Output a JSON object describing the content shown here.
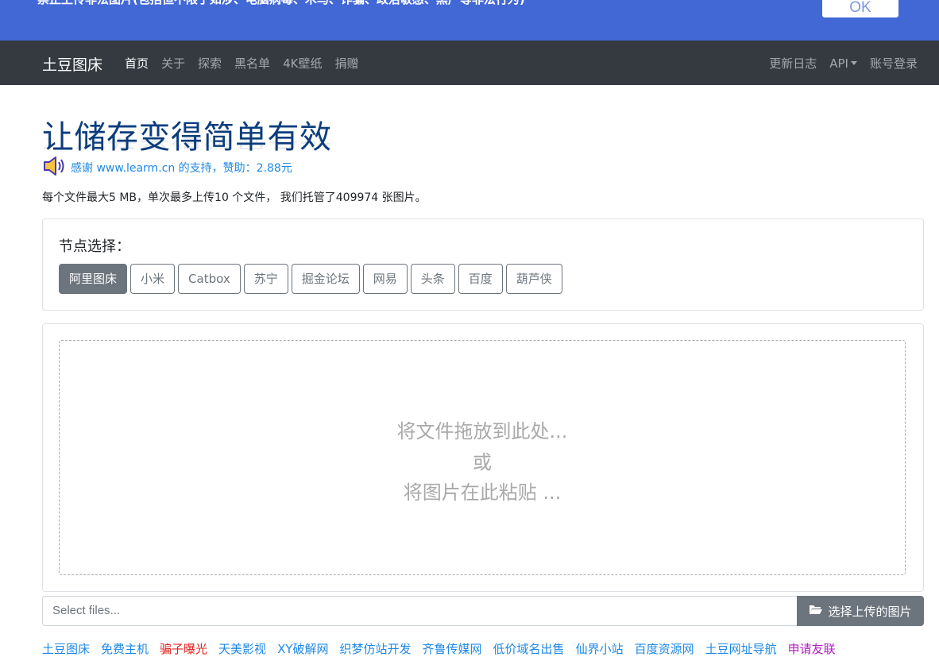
{
  "notice": {
    "text": "禁止上传非法图片(包括但不限于如涉、电脑病毒、木马、诈骗、政治敏感、黑产等非法行为)",
    "ok_label": "OK"
  },
  "navbar": {
    "brand": "土豆图床",
    "left_items": [
      "首页",
      "关于",
      "探索",
      "黑名单",
      "4K壁纸",
      "捐赠"
    ],
    "right_items": [
      "更新日志",
      "API",
      "账号登录"
    ]
  },
  "hero": {
    "title": "让储存变得简单有效",
    "sponsor": "感谢 www.learm.cn 的支持，赞助：2.88元",
    "info": "每个文件最大5 MB，单次最多上传10 个文件， 我们托管了409974 张图片。"
  },
  "nodes": {
    "label": "节点选择：",
    "options": [
      "阿里图床",
      "小米",
      "Catbox",
      "苏宁",
      "掘金论坛",
      "网易",
      "头条",
      "百度",
      "葫芦侠"
    ],
    "selected": "阿里图床"
  },
  "dropzone": {
    "line1": "将文件拖放到此处...",
    "line2": "或",
    "line3": "将图片在此粘贴 ..."
  },
  "file_select": {
    "placeholder": "Select files...",
    "button_label": "选择上传的图片"
  },
  "footer_links": [
    {
      "label": "土豆图床",
      "color": "#1e88e5"
    },
    {
      "label": "免费主机",
      "color": "#1e88e5"
    },
    {
      "label": "骗子曝光",
      "color": "#e02020"
    },
    {
      "label": "天美影视",
      "color": "#1e88e5"
    },
    {
      "label": "XY破解网",
      "color": "#1e88e5"
    },
    {
      "label": "织梦仿站开发",
      "color": "#1e88e5"
    },
    {
      "label": "齐鲁传媒网",
      "color": "#1e88e5"
    },
    {
      "label": "低价域名出售",
      "color": "#1e88e5"
    },
    {
      "label": "仙界小站",
      "color": "#1e88e5"
    },
    {
      "label": "百度资源网",
      "color": "#1e88e5"
    },
    {
      "label": "土豆网址导航",
      "color": "#1e88e5"
    },
    {
      "label": "申请友联",
      "color": "#b020c0"
    }
  ],
  "colors": {
    "notice_bg": "#4268d6",
    "navbar_bg": "#343a40",
    "title": "#0b3d7c",
    "accent_link": "#1e88e5",
    "secondary": "#6c757d"
  }
}
